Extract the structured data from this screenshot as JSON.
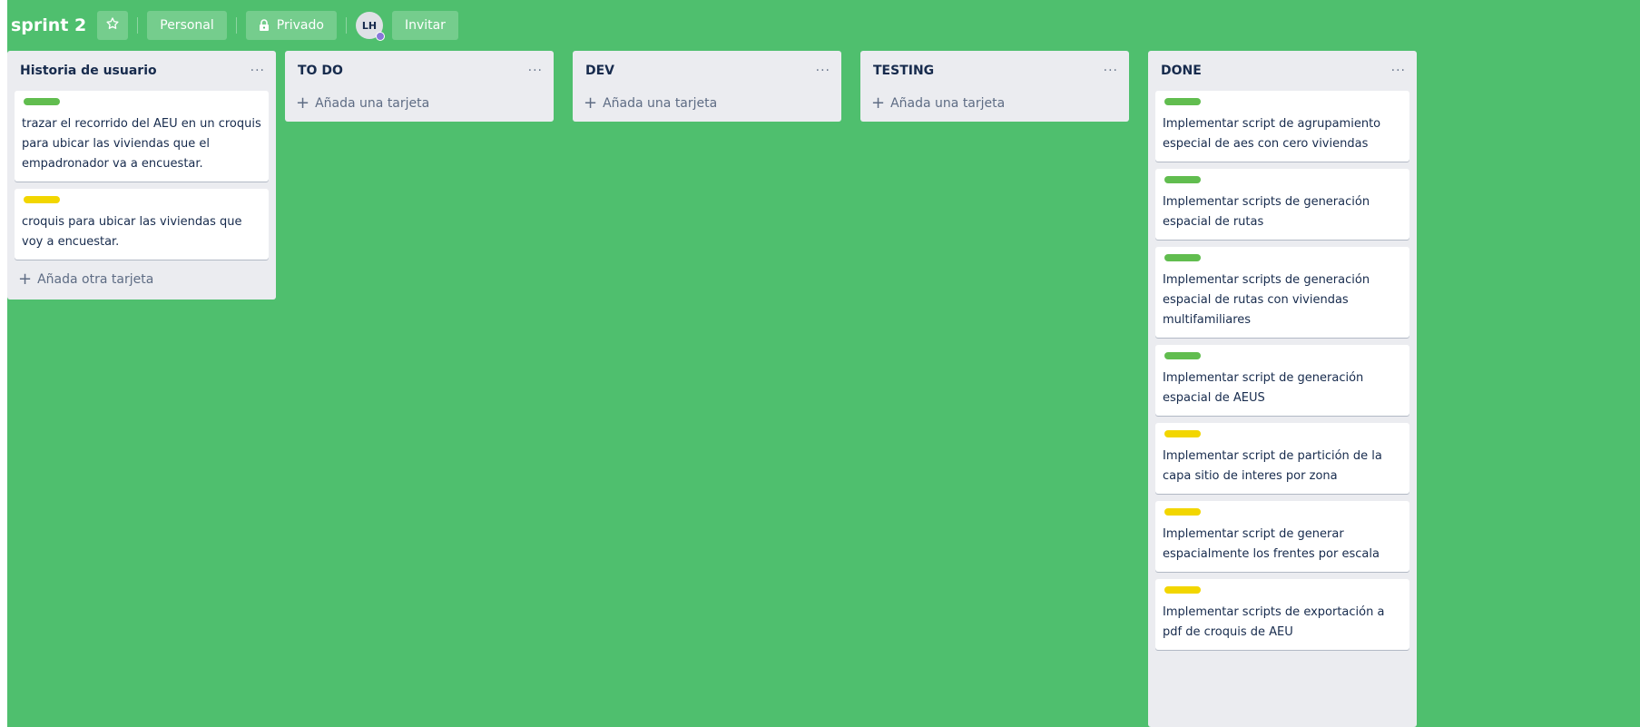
{
  "header": {
    "board_title": "sprint 2",
    "personal_label": "Personal",
    "private_label": "Privado",
    "avatar_initials": "LH",
    "invite_label": "Invitar"
  },
  "lists": [
    {
      "title": "Historia de usuario",
      "more": "···",
      "add_label": "Añada otra tarjeta",
      "cards": [
        {
          "label": "green",
          "text": "trazar el recorrido del AEU en un croquis para ubicar las viviendas que el empadronador va a encuestar."
        },
        {
          "label": "yellow",
          "text": "croquis para ubicar las viviendas que voy a encuestar."
        }
      ]
    },
    {
      "title": "TO DO",
      "more": "···",
      "add_label": "Añada una tarjeta",
      "cards": []
    },
    {
      "title": "DEV",
      "more": "···",
      "add_label": "Añada una tarjeta",
      "cards": []
    },
    {
      "title": "TESTING",
      "more": "···",
      "add_label": "Añada una tarjeta",
      "cards": []
    },
    {
      "title": "DONE",
      "more": "···",
      "cards": [
        {
          "label": "green",
          "text": "Implementar script de agrupamiento especial de aes con cero viviendas"
        },
        {
          "label": "green",
          "text": "Implementar scripts de generación espacial de rutas"
        },
        {
          "label": "green",
          "text": "Implementar scripts de generación espacial de rutas con viviendas multifamiliares"
        },
        {
          "label": "green",
          "text": "Implementar script de generación espacial de AEUS"
        },
        {
          "label": "yellow",
          "text": "Implementar script de partición de la capa sitio de interes por zona"
        },
        {
          "label": "yellow",
          "text": "Implementar script de generar espacialmente los frentes por escala"
        },
        {
          "label": "yellow",
          "text": "Implementar scripts de exportación a pdf de croquis de AEU"
        }
      ]
    }
  ],
  "colors": {
    "board_background": "#4fbf6e",
    "list_background": "#ebecf0",
    "label_green": "#61bd4f",
    "label_yellow": "#f2d600"
  }
}
